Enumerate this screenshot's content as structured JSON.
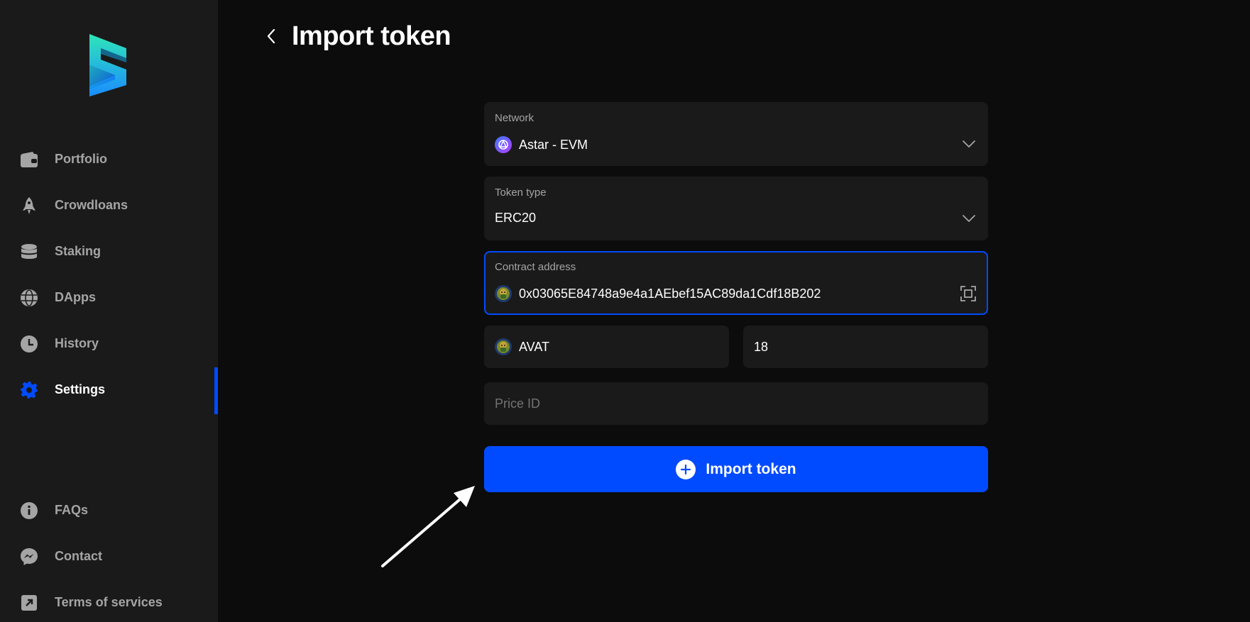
{
  "sidebar": {
    "logo": "subwallet-logo",
    "items": [
      {
        "label": "Portfolio",
        "icon": "wallet-icon"
      },
      {
        "label": "Crowdloans",
        "icon": "rocket-icon"
      },
      {
        "label": "Staking",
        "icon": "database-icon"
      },
      {
        "label": "DApps",
        "icon": "globe-icon"
      },
      {
        "label": "History",
        "icon": "clock-icon"
      },
      {
        "label": "Settings",
        "icon": "gear-icon",
        "active": true
      }
    ],
    "bottom_items": [
      {
        "label": "FAQs",
        "icon": "info-icon"
      },
      {
        "label": "Contact",
        "icon": "messenger-icon"
      },
      {
        "label": "Terms of services",
        "icon": "external-link-icon"
      }
    ]
  },
  "header": {
    "title": "Import token"
  },
  "form": {
    "network": {
      "label": "Network",
      "value": "Astar - EVM"
    },
    "token_type": {
      "label": "Token type",
      "value": "ERC20"
    },
    "contract_address": {
      "label": "Contract address",
      "value": "0x03065E84748a9e4a1AEbef15AC89da1Cdf18B202"
    },
    "symbol": {
      "value": "AVAT"
    },
    "decimals": {
      "value": "18"
    },
    "price_id": {
      "placeholder": "Price ID"
    },
    "submit_label": "Import token"
  },
  "colors": {
    "accent": "#004bff",
    "sidebar_bg": "#1a1a1a",
    "main_bg": "#0c0c0c",
    "field_bg": "#1a1a1a",
    "muted_text": "#a5a5a5"
  }
}
